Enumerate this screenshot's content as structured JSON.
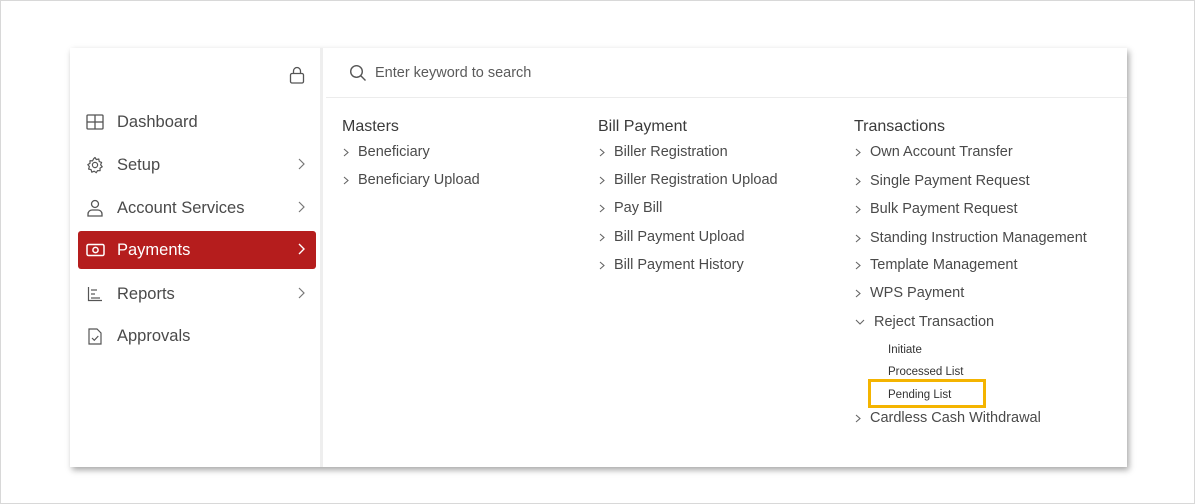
{
  "search": {
    "placeholder": "Enter keyword to search"
  },
  "sidebar": {
    "items": [
      {
        "label": "Dashboard",
        "icon": "grid-icon",
        "has_submenu": false,
        "active": false
      },
      {
        "label": "Setup",
        "icon": "gear-icon",
        "has_submenu": true,
        "active": false
      },
      {
        "label": "Account Services",
        "icon": "user-icon",
        "has_submenu": true,
        "active": false
      },
      {
        "label": "Payments",
        "icon": "banknote-icon",
        "has_submenu": true,
        "active": true
      },
      {
        "label": "Reports",
        "icon": "reports-icon",
        "has_submenu": true,
        "active": false
      },
      {
        "label": "Approvals",
        "icon": "approval-document-icon",
        "has_submenu": false,
        "active": false
      }
    ]
  },
  "menu": {
    "masters": {
      "title": "Masters",
      "links": [
        "Beneficiary",
        "Beneficiary Upload"
      ]
    },
    "bill_payment": {
      "title": "Bill Payment",
      "links": [
        "Biller Registration",
        "Biller Registration Upload",
        "Pay Bill",
        "Bill Payment Upload",
        "Bill Payment History"
      ]
    },
    "transactions": {
      "title": "Transactions",
      "links": [
        "Own Account Transfer",
        "Single Payment Request",
        "Bulk Payment Request",
        "Standing Instruction Management",
        "Template Management",
        "WPS Payment"
      ],
      "expanded": {
        "label": "Reject Transaction",
        "sub_items": [
          "Initiate",
          "Processed List",
          "Pending List"
        ]
      },
      "after": [
        "Cardless Cash Withdrawal"
      ]
    }
  },
  "colors": {
    "active_bg": "#b51d1d",
    "highlight": "#f4b400"
  }
}
